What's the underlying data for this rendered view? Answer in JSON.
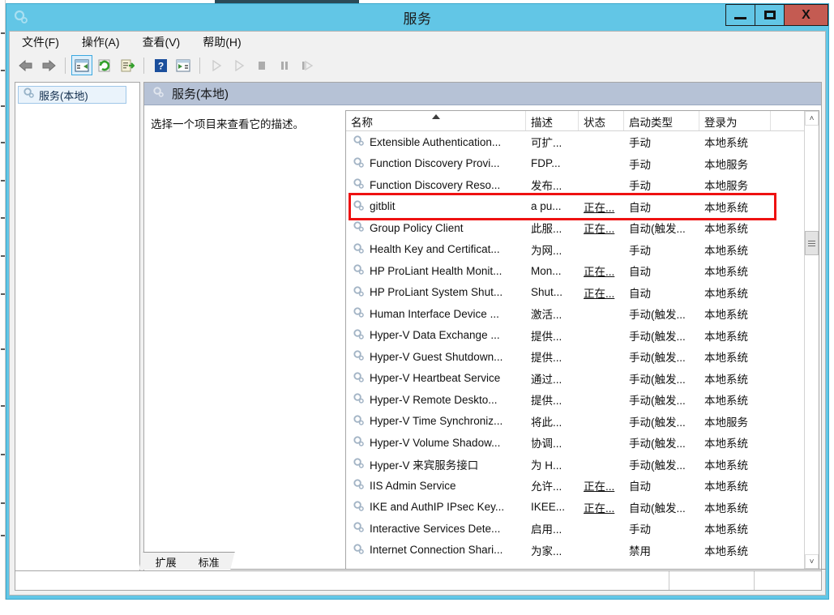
{
  "window": {
    "title": "服务",
    "title_icon": "services-gear-icon",
    "controls": {
      "minimize": "–",
      "maximize": "□",
      "close": "X"
    }
  },
  "menubar": {
    "items": [
      {
        "label": "文件(F)",
        "name": "menu-file"
      },
      {
        "label": "操作(A)",
        "name": "menu-action"
      },
      {
        "label": "查看(V)",
        "name": "menu-view"
      },
      {
        "label": "帮助(H)",
        "name": "menu-help"
      }
    ]
  },
  "toolbar": {
    "buttons": [
      {
        "icon": "back-arrow-icon",
        "enabled": true
      },
      {
        "icon": "forward-arrow-icon",
        "enabled": true
      },
      {
        "icon": "show-hide-console-tree-icon",
        "enabled": true,
        "active": true
      },
      {
        "icon": "refresh-icon",
        "enabled": true
      },
      {
        "icon": "export-list-icon",
        "enabled": true
      },
      {
        "icon": "help-icon",
        "enabled": true
      },
      {
        "icon": "show-action-pane-icon",
        "enabled": true
      },
      {
        "icon": "start-service-icon",
        "enabled": false
      },
      {
        "icon": "resume-service-icon",
        "enabled": false
      },
      {
        "icon": "stop-service-icon",
        "enabled": false
      },
      {
        "icon": "pause-service-icon",
        "enabled": false
      },
      {
        "icon": "restart-service-icon",
        "enabled": false
      }
    ]
  },
  "tree": {
    "root": {
      "label": "服务(本地)",
      "icon": "services-gear-icon",
      "selected": true
    }
  },
  "content": {
    "header_title": "服务(本地)",
    "header_icon": "services-gear-icon",
    "description_hint": "选择一个项目来查看它的描述。"
  },
  "table": {
    "columns": [
      {
        "label": "名称",
        "name": "column-name",
        "sorted": "asc"
      },
      {
        "label": "描述",
        "name": "column-description"
      },
      {
        "label": "状态",
        "name": "column-status"
      },
      {
        "label": "启动类型",
        "name": "column-startup-type"
      },
      {
        "label": "登录为",
        "name": "column-log-on-as"
      }
    ],
    "rows": [
      {
        "name": "Extensible Authentication...",
        "description": "可扩...",
        "status": "",
        "startup": "手动",
        "logon": "本地系统"
      },
      {
        "name": "Function Discovery Provi...",
        "description": "FDP...",
        "status": "",
        "startup": "手动",
        "logon": "本地服务"
      },
      {
        "name": "Function Discovery Reso...",
        "description": "发布...",
        "status": "",
        "startup": "手动",
        "logon": "本地服务"
      },
      {
        "name": "gitblit",
        "description": "a pu...",
        "status": "正在...",
        "startup": "自动",
        "logon": "本地系统",
        "highlighted": true
      },
      {
        "name": "Group Policy Client",
        "description": "此服...",
        "status": "正在...",
        "startup": "自动(触发...",
        "logon": "本地系统"
      },
      {
        "name": "Health Key and Certificat...",
        "description": "为网...",
        "status": "",
        "startup": "手动",
        "logon": "本地系统"
      },
      {
        "name": "HP ProLiant Health Monit...",
        "description": "Mon...",
        "status": "正在...",
        "startup": "自动",
        "logon": "本地系统"
      },
      {
        "name": "HP ProLiant System Shut...",
        "description": "Shut...",
        "status": "正在...",
        "startup": "自动",
        "logon": "本地系统"
      },
      {
        "name": "Human Interface Device ...",
        "description": "激活...",
        "status": "",
        "startup": "手动(触发...",
        "logon": "本地系统"
      },
      {
        "name": "Hyper-V Data Exchange ...",
        "description": "提供...",
        "status": "",
        "startup": "手动(触发...",
        "logon": "本地系统"
      },
      {
        "name": "Hyper-V Guest Shutdown...",
        "description": "提供...",
        "status": "",
        "startup": "手动(触发...",
        "logon": "本地系统"
      },
      {
        "name": "Hyper-V Heartbeat Service",
        "description": "通过...",
        "status": "",
        "startup": "手动(触发...",
        "logon": "本地系统"
      },
      {
        "name": "Hyper-V Remote Deskto...",
        "description": "提供...",
        "status": "",
        "startup": "手动(触发...",
        "logon": "本地系统"
      },
      {
        "name": "Hyper-V Time Synchroniz...",
        "description": "将此...",
        "status": "",
        "startup": "手动(触发...",
        "logon": "本地服务"
      },
      {
        "name": "Hyper-V Volume Shadow...",
        "description": "协调...",
        "status": "",
        "startup": "手动(触发...",
        "logon": "本地系统"
      },
      {
        "name": "Hyper-V 来宾服务接口",
        "description": "为 H...",
        "status": "",
        "startup": "手动(触发...",
        "logon": "本地系统"
      },
      {
        "name": "IIS Admin Service",
        "description": "允许...",
        "status": "正在...",
        "startup": "自动",
        "logon": "本地系统"
      },
      {
        "name": "IKE and AuthIP IPsec Key...",
        "description": "IKEE...",
        "status": "正在...",
        "startup": "自动(触发...",
        "logon": "本地系统"
      },
      {
        "name": "Interactive Services Dete...",
        "description": "启用...",
        "status": "",
        "startup": "手动",
        "logon": "本地系统"
      },
      {
        "name": "Internet Connection Shari...",
        "description": "为家...",
        "status": "",
        "startup": "禁用",
        "logon": "本地系统"
      }
    ]
  },
  "tabs": [
    {
      "label": "扩展",
      "name": "tab-extended",
      "active": true
    },
    {
      "label": "标准",
      "name": "tab-standard",
      "active": false
    }
  ],
  "statusbar": {
    "segment_left": "",
    "segment_middle": "",
    "segment_right": ""
  },
  "scrollbar": {
    "up_arrow": "˄",
    "down_arrow": "˅"
  },
  "colors": {
    "titlebar": "#62c6e6",
    "close_button": "#c45b52",
    "content_header": "#b6c2d6",
    "highlight_box": "#ee1111",
    "tree_selection": "#eaf3fb"
  }
}
